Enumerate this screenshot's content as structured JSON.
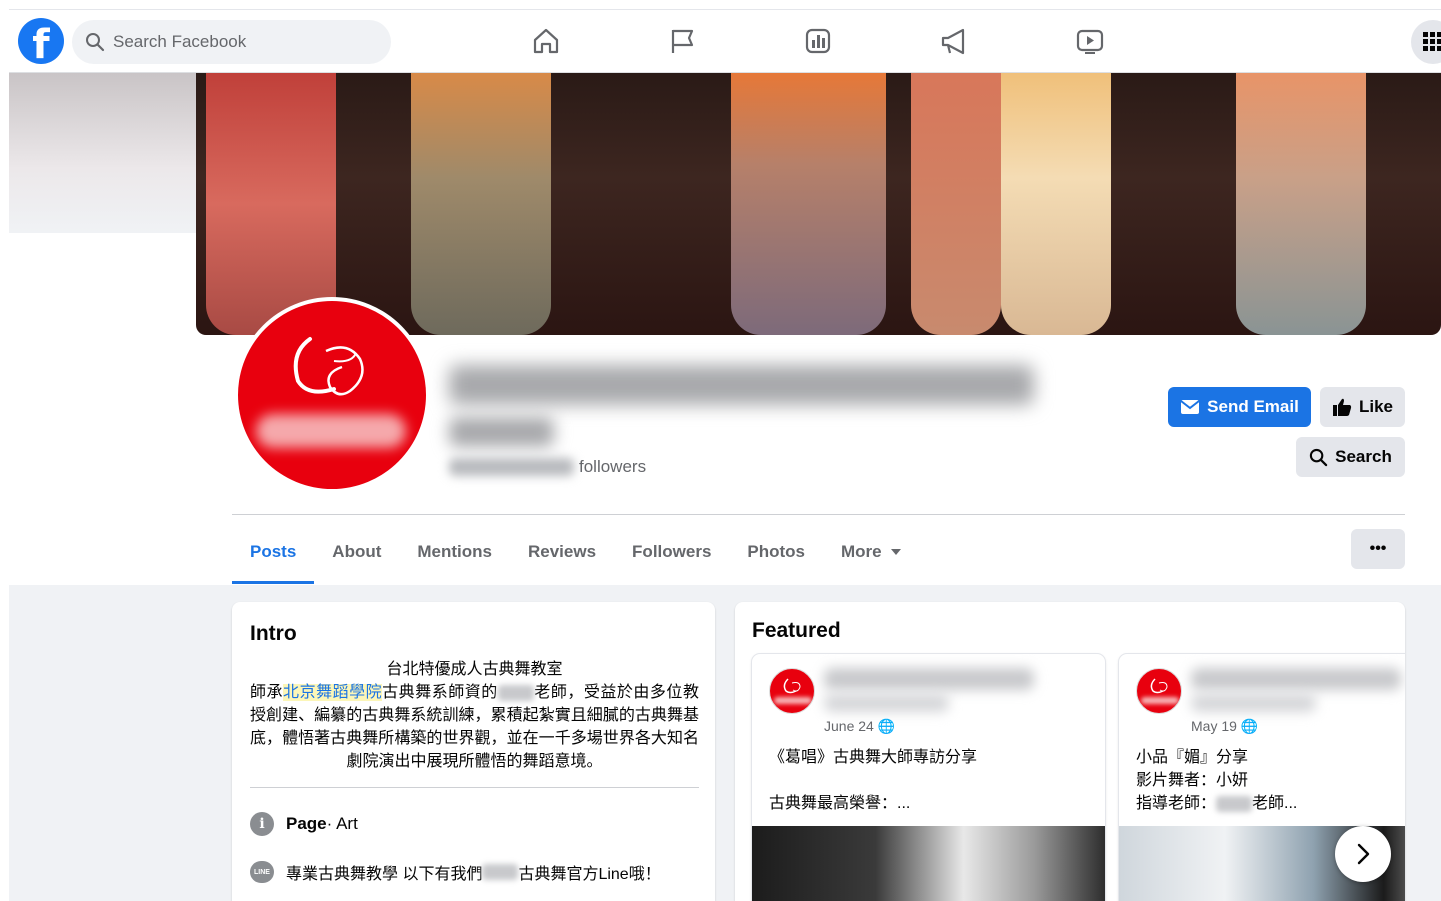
{
  "header": {
    "logo_letter": "f",
    "search_placeholder": "Search Facebook",
    "nav_icons": [
      "home-icon",
      "flag-icon",
      "insights-icon",
      "megaphone-icon",
      "video-icon"
    ],
    "apps_icon": "grid-menu-icon"
  },
  "profile": {
    "followers_label": "followers",
    "actions": {
      "send_email": "Send Email",
      "like": "Like",
      "search": "Search"
    }
  },
  "tabs": [
    {
      "label": "Posts",
      "active": true
    },
    {
      "label": "About",
      "active": false
    },
    {
      "label": "Mentions",
      "active": false
    },
    {
      "label": "Reviews",
      "active": false
    },
    {
      "label": "Followers",
      "active": false
    },
    {
      "label": "Photos",
      "active": false
    },
    {
      "label": "More",
      "active": false
    }
  ],
  "more_menu_label": "•••",
  "intro": {
    "title": "Intro",
    "bio_line1": "台北特優成人古典舞教室",
    "bio_prefix": "師承",
    "bio_highlight": "北京舞蹈學院",
    "bio_mid": "古典舞系師資的",
    "bio_rest1": "老師，受益於由多位",
    "bio_rest2": "教授創建、編纂的古典舞系統訓練，累積起紮實且細膩的古典舞基底，體悟著古典舞所構築的世界觀，並在一千多場世界各大知名劇院演出中展現所體悟的舞蹈意境。",
    "page_label": "Page",
    "page_category": " · Art",
    "line_text_a": "專業古典舞教學 以下有我們",
    "line_text_b": "古典舞官方Line哦！",
    "line_icon_text": "LINE"
  },
  "featured": {
    "title": "Featured",
    "items": [
      {
        "date": "June 24",
        "text_line1": "《葛唱》古典舞大師專訪分享",
        "text_line2": "",
        "text_line3": "古典舞最高榮譽：..."
      },
      {
        "date": "May 19",
        "text_line1": "小品『媚』分享",
        "text_line2": "影片舞者：小妍",
        "text_line3": "指導老師："
      }
    ],
    "item2_suffix": "老師..."
  },
  "colors": {
    "brand": "#1877f2",
    "primary_button": "#1b74e4",
    "avatar_red": "#e8000e"
  }
}
